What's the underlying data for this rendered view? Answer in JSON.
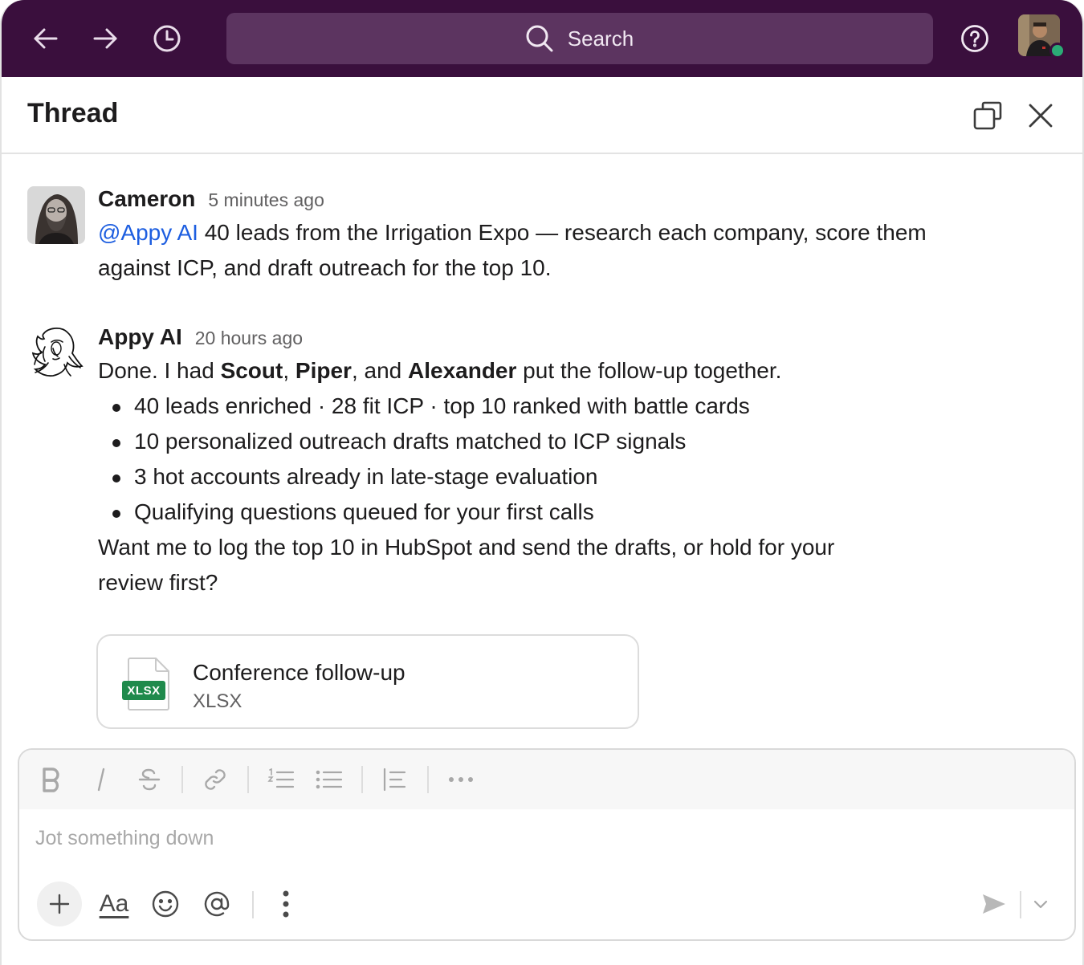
{
  "topbar": {
    "search_placeholder": "Search",
    "icons": [
      "arrow-left-icon",
      "arrow-right-icon",
      "history-clock-icon",
      "search-icon",
      "help-icon"
    ]
  },
  "thread": {
    "title": "Thread"
  },
  "messages": [
    {
      "author": "Cameron",
      "time": "5 minutes ago",
      "mention": "@Appy AI",
      "text": " 40 leads from the Irrigation Expo — research each company, score them against ICP, and draft outreach for the top 10."
    },
    {
      "author": "Appy AI",
      "time": "20 hours ago",
      "intro_prefix": "Done. I had ",
      "intro_name1": "Scout",
      "intro_sep1": ", ",
      "intro_name2": "Piper",
      "intro_sep2": ", and ",
      "intro_name3": "Alexander",
      "intro_suffix": " put the follow-up together.",
      "bullets": [
        "40 leads enriched · 28 fit ICP · top 10 ranked with battle cards",
        "10 personalized outreach drafts matched to ICP signals",
        "3 hot accounts already in late-stage evaluation",
        "Qualifying questions queued for your first calls"
      ],
      "closing": "Want me to log the top 10 in HubSpot and send the drafts, or hold for your review first?"
    }
  ],
  "attachment": {
    "name": "Conference follow-up",
    "type": "XLSX",
    "badge": "XLSX",
    "badge_color": "#1f8a4c"
  },
  "composer": {
    "placeholder": "Jot something down",
    "font_button": "Aa"
  },
  "colors": {
    "topbar": "#3a0f3d",
    "search_bg": "#5c3460",
    "mention": "#1d5ee0",
    "presence": "#2bac76"
  }
}
